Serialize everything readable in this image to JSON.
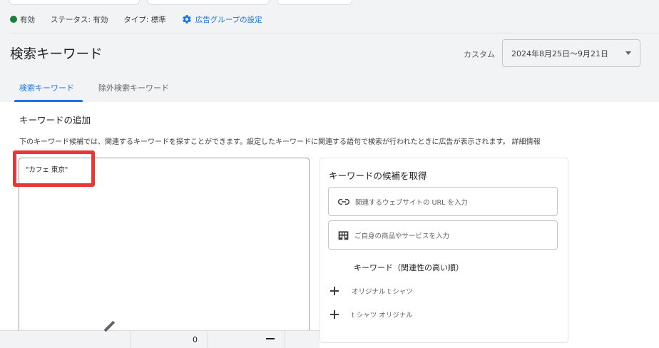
{
  "status_bar": {
    "status": "有効",
    "status_color": "#188038",
    "status_detail": "ステータス: 有効",
    "type_detail": "タイプ: 標準",
    "settings_link": "広告グループの設定",
    "settings_icon": "gear-icon"
  },
  "header": {
    "title": "検索キーワード",
    "date_range_label": "カスタム",
    "date_range_value": "2024年8月25日〜9月21日",
    "accent": "#1a73e8"
  },
  "tabs": [
    {
      "label": "検索キーワード",
      "active": true
    },
    {
      "label": "除外検索キーワード",
      "active": false
    }
  ],
  "add_keywords": {
    "title": "キーワードの追加",
    "description": "下のキーワード候補では、関連するキーワードを探すことができます。設定したキーワードに関連する語句で検索が行われたときに広告が表示されます。 詳細情報",
    "textarea_value": "\"カフェ 東京\"",
    "highlight_color": "#e53935"
  },
  "suggestions": {
    "title": "キーワードの候補を取得",
    "url_placeholder": "関連するウェブサイトの URL を入力",
    "url_icon": "link-icon",
    "product_placeholder": "ご自身の商品やサービスを入力",
    "product_icon": "store-icon",
    "list_header": "キーワード（関連性の高い順）",
    "items": [
      "オリジナル t シャツ",
      "t シャツ オリジナル"
    ]
  },
  "bottom_row": {
    "value": "0",
    "edit_icon": "pencil-icon"
  }
}
